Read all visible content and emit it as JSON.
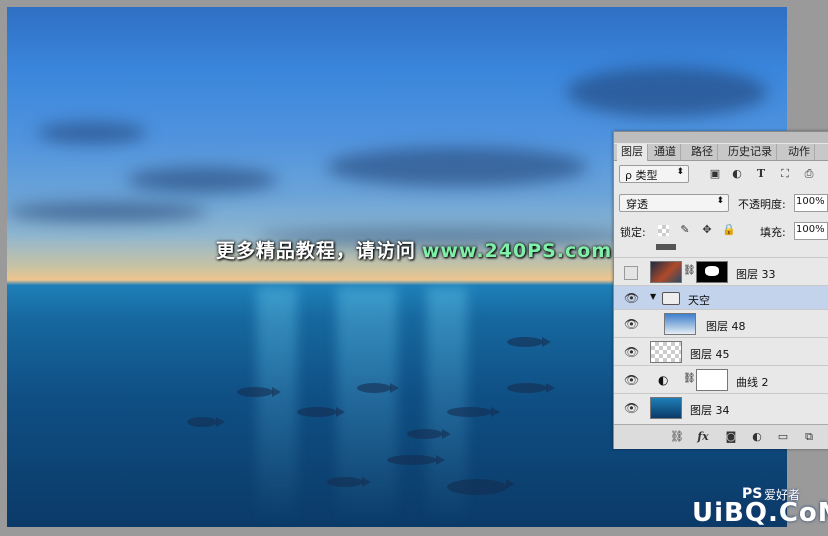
{
  "watermark": {
    "text": "更多精品教程，请访问",
    "url": "www.240PS.com"
  },
  "logo": {
    "ps": "PS",
    "sub": "爱好者",
    "big": "UiBQ.CoM"
  },
  "panel": {
    "tabs": [
      "图层",
      "通道",
      "路径",
      "历史记录",
      "动作"
    ],
    "filter_label": "ρ 类型",
    "filter_icons": [
      "image-icon",
      "adjust-icon",
      "T",
      "transform-icon",
      "smart-icon"
    ],
    "blend_mode": "穿透",
    "opacity_label": "不透明度:",
    "opacity_value": "100%",
    "lock_label": "锁定:",
    "fill_label": "填充:",
    "fill_value": "100%",
    "layers": [
      {
        "name": "图层 33",
        "visible": false
      },
      {
        "name": "天空",
        "visible": true,
        "group": true
      },
      {
        "name": "图层 48",
        "visible": true
      },
      {
        "name": "图层 45",
        "visible": true
      },
      {
        "name": "曲线 2",
        "visible": true
      },
      {
        "name": "图层 34",
        "visible": true
      }
    ],
    "bottom_icons": [
      "link-icon",
      "fx",
      "mask-icon",
      "adjustment-icon",
      "folder-icon",
      "new-layer-icon"
    ]
  }
}
